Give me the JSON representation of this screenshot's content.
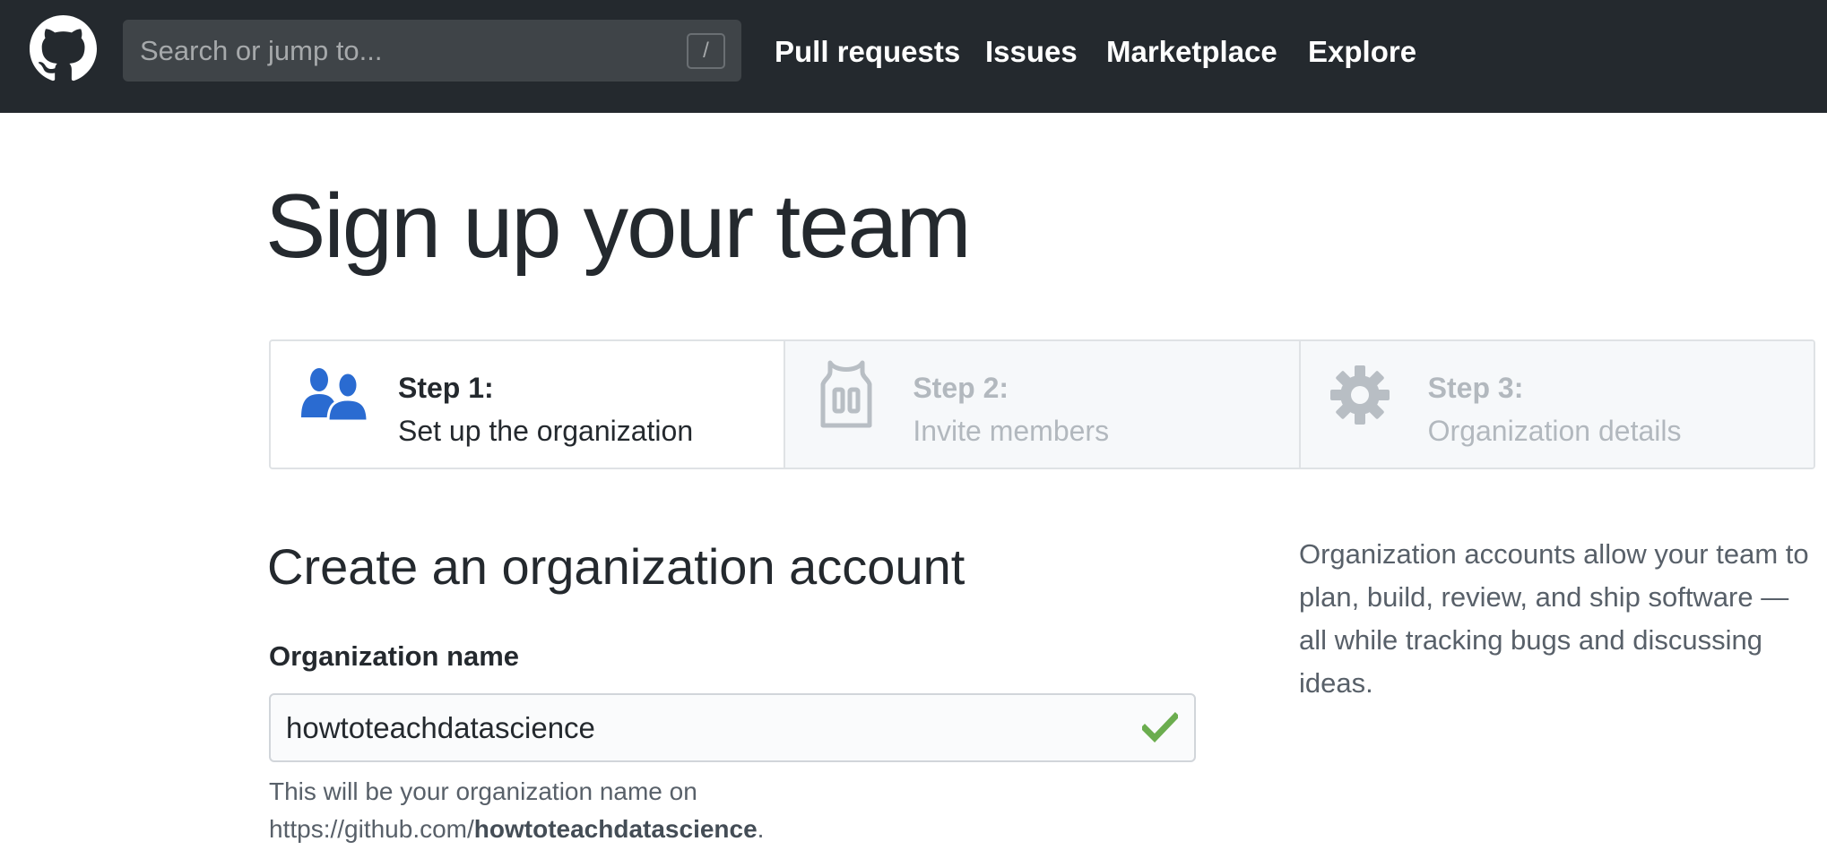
{
  "header": {
    "search_placeholder": "Search or jump to...",
    "search_shortcut": "/",
    "nav": {
      "pull_requests": "Pull requests",
      "issues": "Issues",
      "marketplace": "Marketplace",
      "explore": "Explore"
    }
  },
  "page": {
    "title": "Sign up your team"
  },
  "steps": [
    {
      "title": "Step 1:",
      "description": "Set up the organization",
      "icon": "people-icon",
      "state": "active"
    },
    {
      "title": "Step 2:",
      "description": "Invite members",
      "icon": "jersey-icon",
      "state": "inactive"
    },
    {
      "title": "Step 3:",
      "description": "Organization details",
      "icon": "gear-icon",
      "state": "inactive"
    }
  ],
  "form": {
    "section_title": "Create an organization account",
    "org_name_label": "Organization name",
    "org_name_value": "howtoteachdatascience",
    "helper_prefix": "This will be your organization name on",
    "helper_url_base": "https://github.com/",
    "helper_url_name": "howtoteachdatascience",
    "helper_suffix": "."
  },
  "aside": {
    "text": "Organization accounts allow your team to plan, build, review, and ship software — all while tracking bugs and discussing ideas."
  },
  "colors": {
    "header_bg": "#24292e",
    "active_icon": "#2a6bd1",
    "valid_check": "#6bad4f",
    "inactive_text": "#b2b8be"
  }
}
